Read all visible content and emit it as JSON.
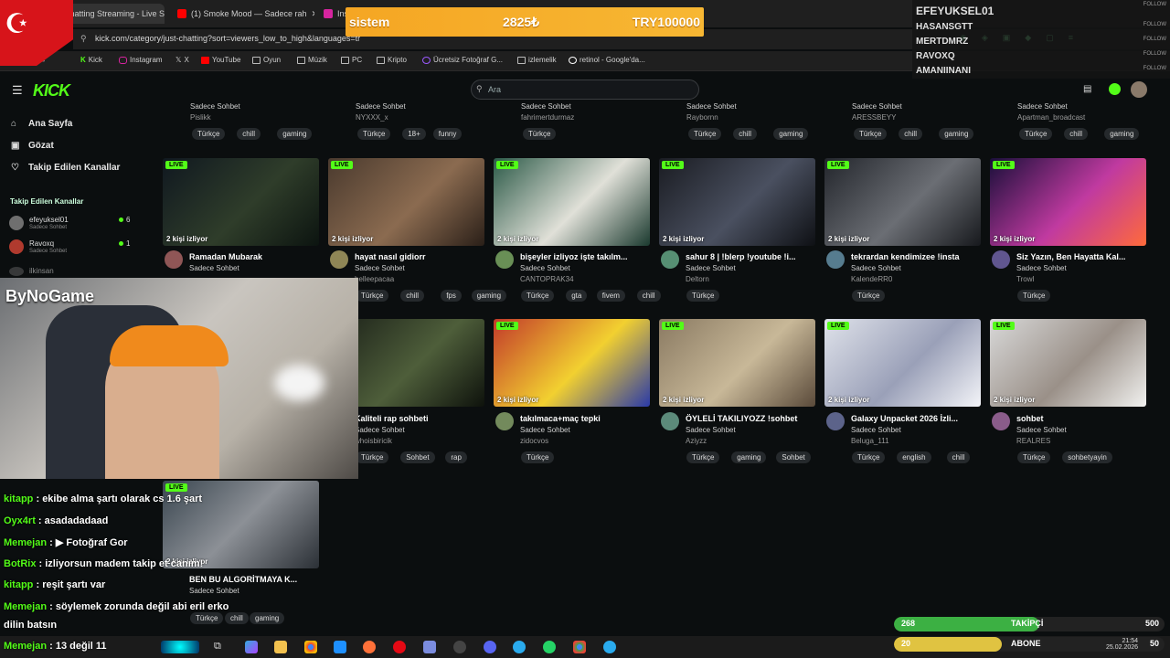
{
  "browser": {
    "tabs": [
      {
        "label": "Just Chatting Streaming - Live S",
        "color": "#53fc18"
      },
      {
        "label": "(1) Smoke Mood — Sadece rah",
        "color": "#ff0000"
      },
      {
        "label": "Ins",
        "color": "#d6249f"
      }
    ],
    "url": "kick.com/category/just-chatting?sort=viewers_low_to_high&languages=tr",
    "bookmarks": [
      "Kick",
      "Instagram",
      "X",
      "YouTube",
      "Oyun",
      "Müzik",
      "PC",
      "Kripto",
      "Ücretsiz Fotoğraf G...",
      "izlemelik",
      "retinol - Google'da..."
    ]
  },
  "donation": {
    "name": "sistem",
    "amount": "2825₺",
    "goal": "TRY100000"
  },
  "follow_overlay": {
    "names": [
      "EFEYUKSEL01",
      "HASANSGTT",
      "MERTDMRZ",
      "RAVOXQ",
      "AMANIINANI"
    ],
    "tag": "FOLLOW"
  },
  "kick": {
    "logo": "KICK",
    "search_placeholder": "Ara",
    "nav": [
      {
        "label": "Ana Sayfa",
        "icon": "home-icon"
      },
      {
        "label": "Gözat",
        "icon": "browse-icon"
      },
      {
        "label": "Takip Edilen Kanallar",
        "icon": "heart-icon"
      }
    ],
    "followed_title": "Takip Edilen Kanallar",
    "followed": [
      {
        "name": "efeyuksel01",
        "cat": "Sadece Sohbet",
        "viewers": "6"
      },
      {
        "name": "Ravoxq",
        "cat": "Sadece Sohbet",
        "viewers": "1"
      },
      {
        "name": "ilkinsan",
        "cat": "",
        "viewers": ""
      }
    ]
  },
  "row0": [
    {
      "cat": "Sadece Sohbet",
      "name": "Pislikk",
      "tags": [
        "Türkçe",
        "chill",
        "gaming"
      ]
    },
    {
      "cat": "Sadece Sohbet",
      "name": "NYXXX_x",
      "tags": [
        "Türkçe",
        "18+",
        "funny"
      ]
    },
    {
      "cat": "Sadece Sohbet",
      "name": "fahrimertdurmaz",
      "tags": [
        "Türkçe"
      ]
    },
    {
      "cat": "Sadece Sohbet",
      "name": "Raybornn",
      "tags": [
        "Türkçe",
        "chill",
        "gaming"
      ]
    },
    {
      "cat": "Sadece Sohbet",
      "name": "ARESSBEYY",
      "tags": [
        "Türkçe",
        "chill",
        "gaming"
      ]
    },
    {
      "cat": "Sadece Sohbet",
      "name": "Apartman_broadcast",
      "tags": [
        "Türkçe",
        "chill",
        "gaming"
      ]
    }
  ],
  "row1": [
    {
      "title": "Ramadan Mubarak",
      "cat": "Sadece Sohbet",
      "name": "",
      "viewers": "2 kişi izliyor",
      "tags": []
    },
    {
      "title": "hayat nasıl gidiorr",
      "cat": "Sadece Sohbet",
      "name": "helleepacaa",
      "viewers": "2 kişi izliyor",
      "tags": [
        "Türkçe",
        "chill",
        "fps",
        "gaming"
      ]
    },
    {
      "title": "bişeyler izliyoz işte takılm...",
      "cat": "Sadece Sohbet",
      "name": "CANTOPRAK34",
      "viewers": "2 kişi izliyor",
      "tags": [
        "Türkçe",
        "gta",
        "fivem",
        "chill"
      ]
    },
    {
      "title": "sahur 8 | !blerp !youtube !i...",
      "cat": "Sadece Sohbet",
      "name": "Deltorn",
      "viewers": "2 kişi izliyor",
      "tags": [
        "Türkçe"
      ]
    },
    {
      "title": "tekrardan kendimizee !insta",
      "cat": "Sadece Sohbet",
      "name": "KalendeRR0",
      "viewers": "2 kişi izliyor",
      "tags": [
        "Türkçe"
      ]
    },
    {
      "title": "Siz Yazın, Ben Hayatta Kal...",
      "cat": "Sadece Sohbet",
      "name": "Trowl",
      "viewers": "2 kişi izliyor",
      "tags": [
        "Türkçe"
      ]
    }
  ],
  "row2": [
    {
      "title": "Kaliteli rap sohbeti",
      "cat": "Sadece Sohbet",
      "name": "whoisbiricik",
      "viewers": "izliyor",
      "tags": [
        "Türkçe",
        "Sohbet",
        "rap"
      ]
    },
    {
      "title": "takılmaca+maç tepki",
      "cat": "Sadece Sohbet",
      "name": "zidocvos",
      "viewers": "2 kişi izliyor",
      "tags": [
        "Türkçe"
      ]
    },
    {
      "title": "ÖYLELİ TAKILIYOZZ !sohbet",
      "cat": "Sadece Sohbet",
      "name": "Aziyzz",
      "viewers": "2 kişi izliyor",
      "tags": [
        "Türkçe",
        "gaming",
        "Sohbet"
      ]
    },
    {
      "title": "Galaxy Unpacket 2026 İzli...",
      "cat": "Sadece Sohbet",
      "name": "Beluga_111",
      "viewers": "2 kişi izliyor",
      "tags": [
        "Türkçe",
        "english",
        "chill"
      ]
    },
    {
      "title": "sohbet",
      "cat": "Sadece Sohbet",
      "name": "REALRES",
      "viewers": "2 kişi izliyor",
      "tags": [
        "Türkçe",
        "sohbetyayin"
      ]
    }
  ],
  "row3": {
    "title": "BEN BU ALGORİTMAYA K...",
    "cat": "Sadece Sohbet",
    "viewers": "2 kişi izliyor",
    "tags": [
      "Türkçe",
      "chill",
      "gaming"
    ]
  },
  "webcam": {
    "title": "ByNoGame"
  },
  "chat": [
    {
      "user": "kitapp",
      "msg": "ekibe alma şartı olarak cs 1.6 şart"
    },
    {
      "user": "Oyx4rt",
      "msg": "asadadadaad"
    },
    {
      "user": "Memejan",
      "msg": "▶ Fotoğraf Gor"
    },
    {
      "user": "BotRix",
      "msg": "izliyorsun madem takip et canım!"
    },
    {
      "user": "kitapp",
      "msg": "reşit şartı var"
    },
    {
      "user": "Memejan",
      "msg": "söylemek zorunda değil abi eril erko"
    },
    {
      "user": "",
      "msg": "dilin batsın"
    },
    {
      "user": "Memejan",
      "msg": "13 değil 11"
    }
  ],
  "bars": {
    "follow": {
      "current": "268",
      "label": "TAKİPÇİ",
      "goal": "500",
      "fraction": 0.536,
      "color": "#3cb043"
    },
    "sub": {
      "current": "20",
      "label": "ABONE",
      "goal": "50",
      "fraction": 0.4,
      "color": "#e0c341"
    }
  },
  "taskbar": {
    "time": "21:54",
    "date": "25.02.2026"
  }
}
